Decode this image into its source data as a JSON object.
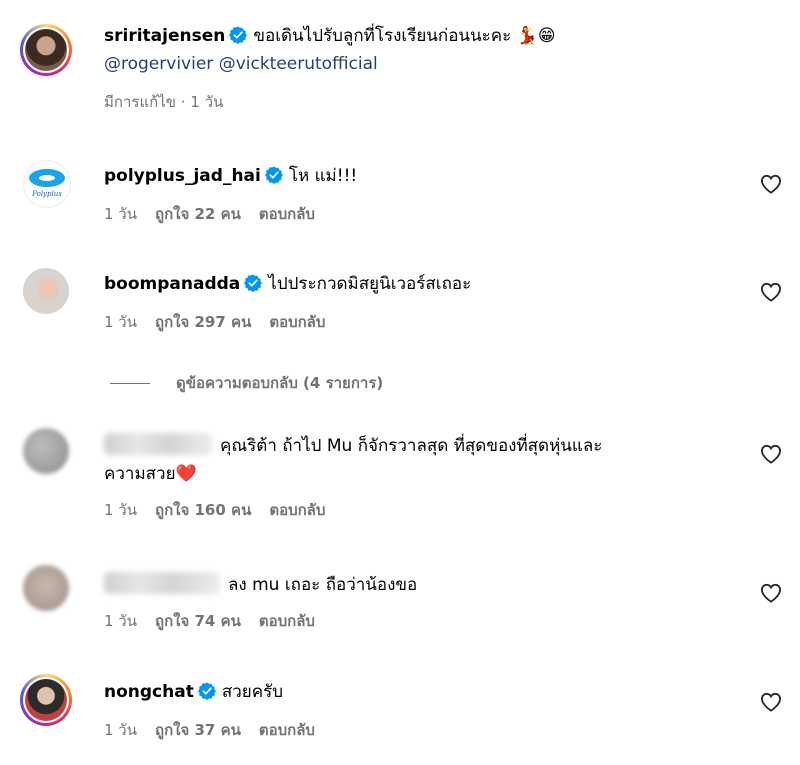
{
  "post": {
    "username": "sriritajensen",
    "caption": "ขอเดินไปรับลูกที่โรงเรียนก่อนนะคะ",
    "caption_emojis": "💃😁",
    "mentions": [
      "@rogervivier",
      "@vickteerutofficial"
    ],
    "meta": "มีการแก้ไข · 1 วัน"
  },
  "comments": [
    {
      "username": "polyplus_jad_hai",
      "verified": true,
      "text": "โห แม่!!!",
      "time": "1 วัน",
      "likes": "ถูกใจ 22 คน",
      "reply": "ตอบกลับ"
    },
    {
      "username": "boompanadda",
      "verified": true,
      "text": "ไปประกวดมิสยูนิเวอร์สเถอะ",
      "time": "1 วัน",
      "likes": "ถูกใจ 297 คน",
      "reply": "ตอบกลับ",
      "view_replies": "ดูข้อความตอบกลับ (4 รายการ)"
    },
    {
      "username": "",
      "verified": false,
      "text_line1": "คุณริต้า ถ้าไป Mu ก็จักรวาลสุด ที่สุดของที่สุดหุ่นและ",
      "text_line2": "ความสวย",
      "text_emoji": "❤️",
      "time": "1 วัน",
      "likes": "ถูกใจ 160 คน",
      "reply": "ตอบกลับ"
    },
    {
      "username": "",
      "verified": false,
      "text": "ลง mu เถอะ ถือว่าน้องขอ",
      "time": "1 วัน",
      "likes": "ถูกใจ 74 คน",
      "reply": "ตอบกลับ"
    },
    {
      "username": "nongchat",
      "verified": true,
      "text": "สวยครับ",
      "time": "1 วัน",
      "likes": "ถูกใจ 37 คน",
      "reply": "ตอบกลับ"
    }
  ],
  "colors": {
    "verified_blue": "#0095f6",
    "meta_gray": "#737373",
    "mention_blue": "#2a3f73"
  },
  "icons": {
    "like": "heart-outline-icon",
    "verified": "verified-badge-icon"
  }
}
